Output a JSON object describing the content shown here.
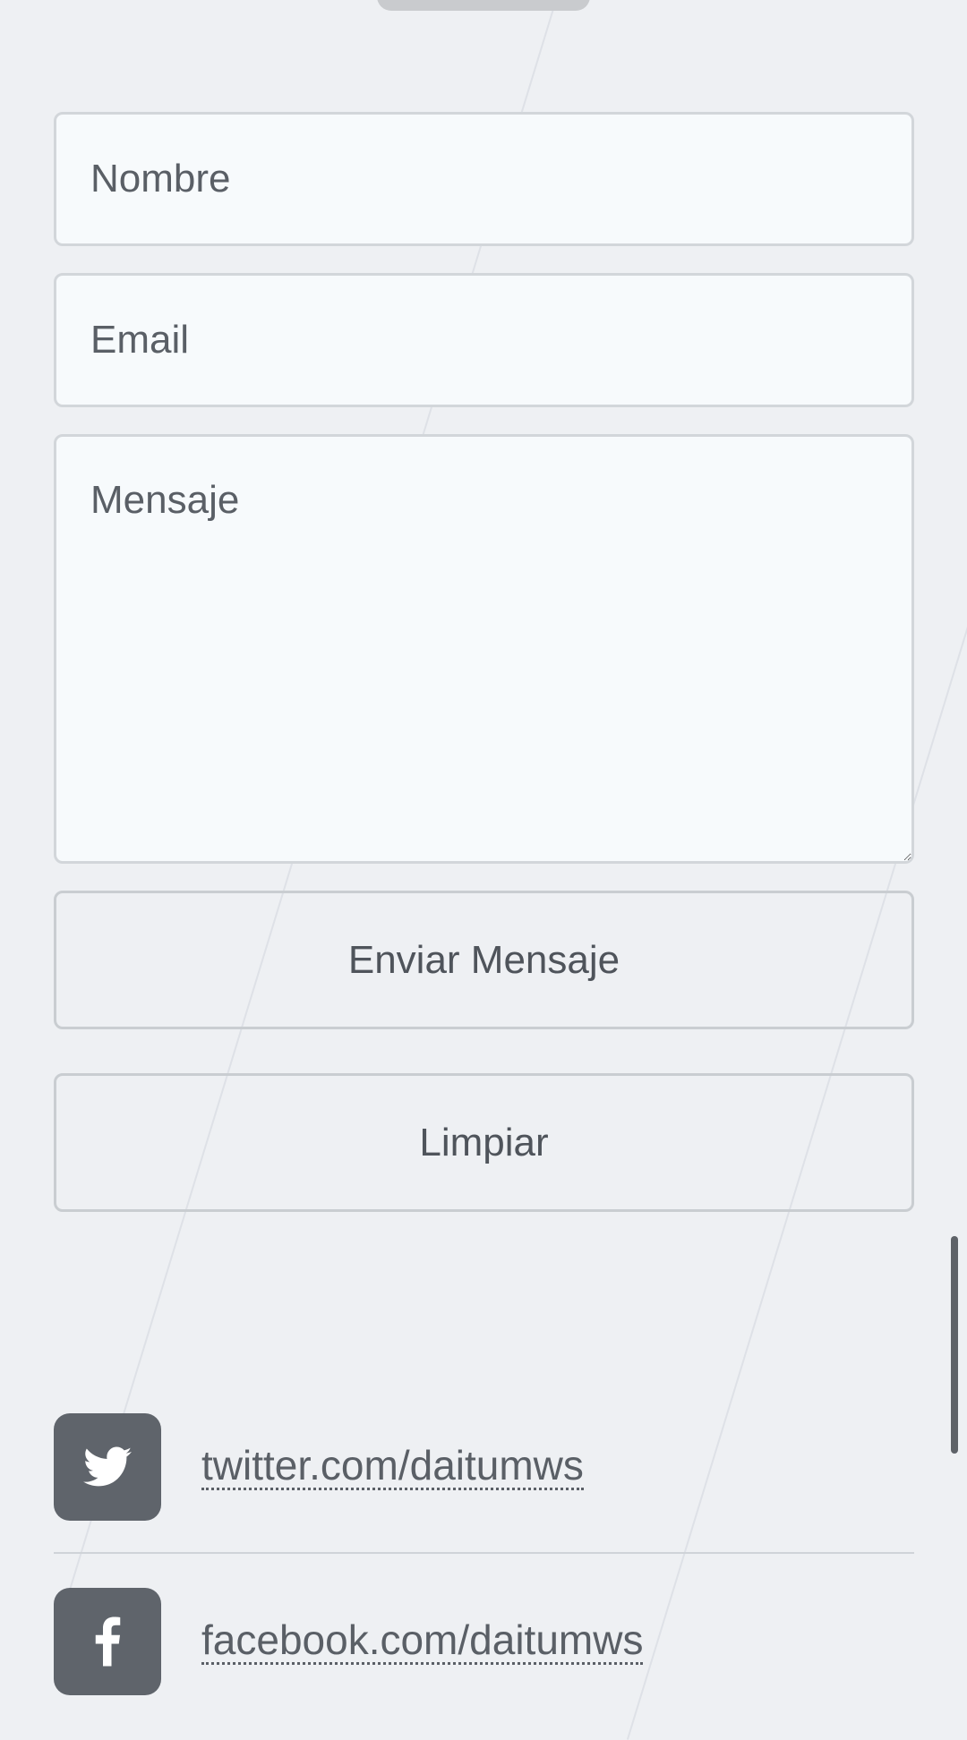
{
  "form": {
    "name_placeholder": "Nombre",
    "email_placeholder": "Email",
    "message_placeholder": "Mensaje",
    "send_label": "Enviar Mensaje",
    "clear_label": "Limpiar"
  },
  "social": {
    "twitter": {
      "icon": "twitter-icon",
      "label": "twitter.com/daitumws"
    },
    "facebook": {
      "icon": "facebook-icon",
      "label": "facebook.com/daitumws"
    }
  },
  "colors": {
    "background": "#eef0f3",
    "field_background": "#f7fafc",
    "border": "#d2d6da",
    "icon_tile": "#5f646b",
    "text": "#5a5f66"
  }
}
